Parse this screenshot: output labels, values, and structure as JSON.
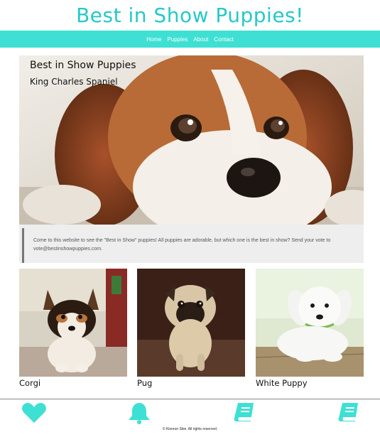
{
  "site": {
    "title": "Best in Show Puppies!"
  },
  "nav": {
    "items": [
      "Home",
      "Puppies",
      "About",
      "Contact"
    ]
  },
  "hero": {
    "title": "Best in Show Puppies",
    "subtitle": "King Charles Spaniel",
    "image": "king-charles-spaniel-photo"
  },
  "notice": {
    "text": "Come to this website to see the \"Best in Show\" puppies! All puppies are adorable, but which one is the best in show? Send your vote to vote@bestinshowpuppies.com."
  },
  "cards": [
    {
      "label": "Corgi",
      "image": "corgi-puppy-photo"
    },
    {
      "label": "Pug",
      "image": "pug-puppy-photo"
    },
    {
      "label": "White Puppy",
      "image": "white-puppy-photo"
    }
  ],
  "footer": {
    "icons": [
      "heart-icon",
      "bell-icon",
      "book-icon",
      "book-icon"
    ],
    "copyright": "© Kiereon Skie. All rights reserved."
  },
  "colors": {
    "accent": "#27c8c8",
    "navbar": "#3ee0d4",
    "notice_bg": "#eeeeee"
  }
}
